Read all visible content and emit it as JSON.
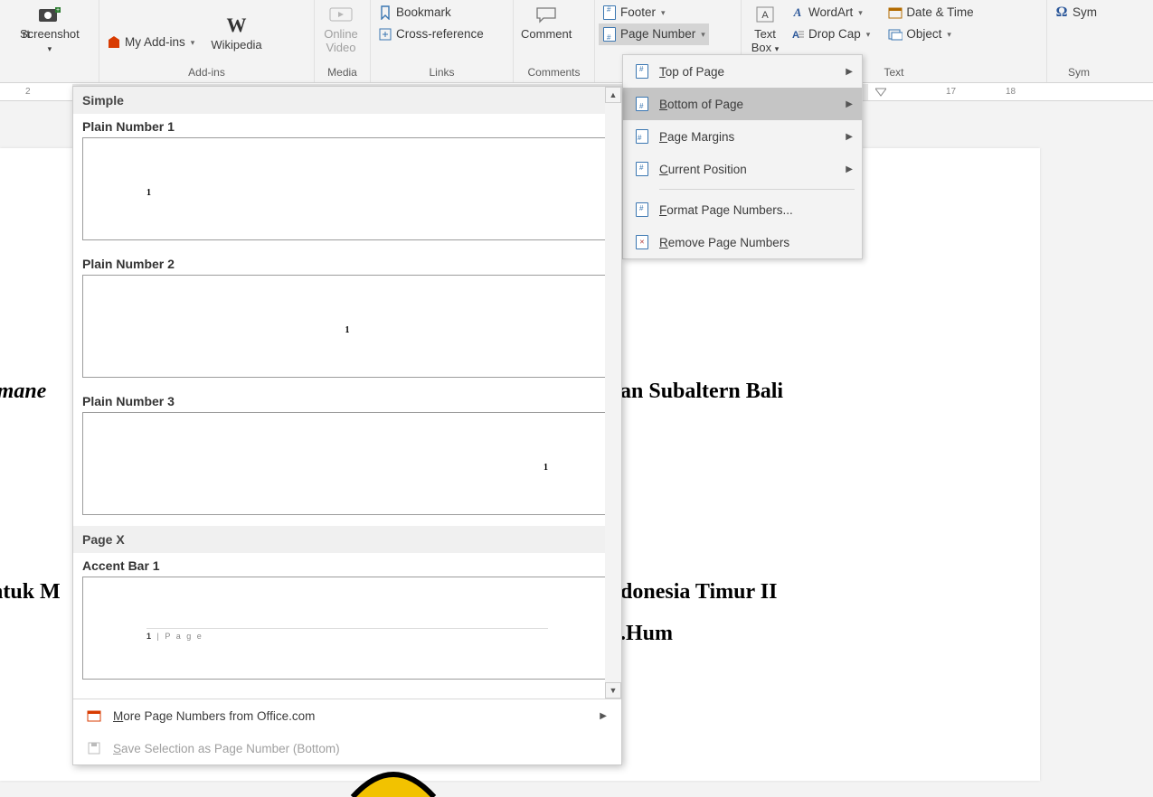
{
  "ribbon": {
    "rt_label": "rt",
    "screenshot_label": "Screenshot",
    "myaddins_label": "My Add-ins",
    "wikipedia_label": "Wikipedia",
    "addins_group": "Add-ins",
    "onlinevideo_line1": "Online",
    "onlinevideo_line2": "Video",
    "media_group": "Media",
    "bookmark_label": "Bookmark",
    "crossref_label": "Cross-reference",
    "links_group": "Links",
    "comment_label": "Comment",
    "comments_group": "Comments",
    "footer_label": "Footer",
    "pagenumber_label": "Page Number",
    "textbox_line1": "Text",
    "textbox_line2": "Box",
    "wordart_label": "WordArt",
    "dropcap_label": "Drop Cap",
    "datetime_label": "Date & Time",
    "object_label": "Object",
    "text_group": "Text",
    "symbol_label": "Sym",
    "symbol_group": "Sym"
  },
  "ruler": {
    "left_mark": "2",
    "r1": "17",
    "r2": "18"
  },
  "submenu": {
    "top": "Top of Page",
    "bottom": "Bottom of Page",
    "margins": "Page Margins",
    "current": "Current Position",
    "format": "Format Page Numbers...",
    "remove": "Remove Page Numbers"
  },
  "gallery": {
    "cat_simple": "Simple",
    "items": [
      {
        "label": "Plain Number 1",
        "pos": "left"
      },
      {
        "label": "Plain Number 2",
        "pos": "center"
      },
      {
        "label": "Plain Number 3",
        "pos": "right"
      }
    ],
    "cat_pagex": "Page X",
    "accent_label": "Accent Bar 1",
    "accent_text": "1 | P a g e",
    "sample_num": "1",
    "more": "More Page Numbers from Office.com",
    "save": "Save Selection as Page Number (Bottom)"
  },
  "document": {
    "line1a": "lmane",
    "line1b": "an Subaltern Bali",
    "line2a": "ntuk M",
    "line2b": "donesia Timur II",
    "line3b": ".Hum"
  }
}
